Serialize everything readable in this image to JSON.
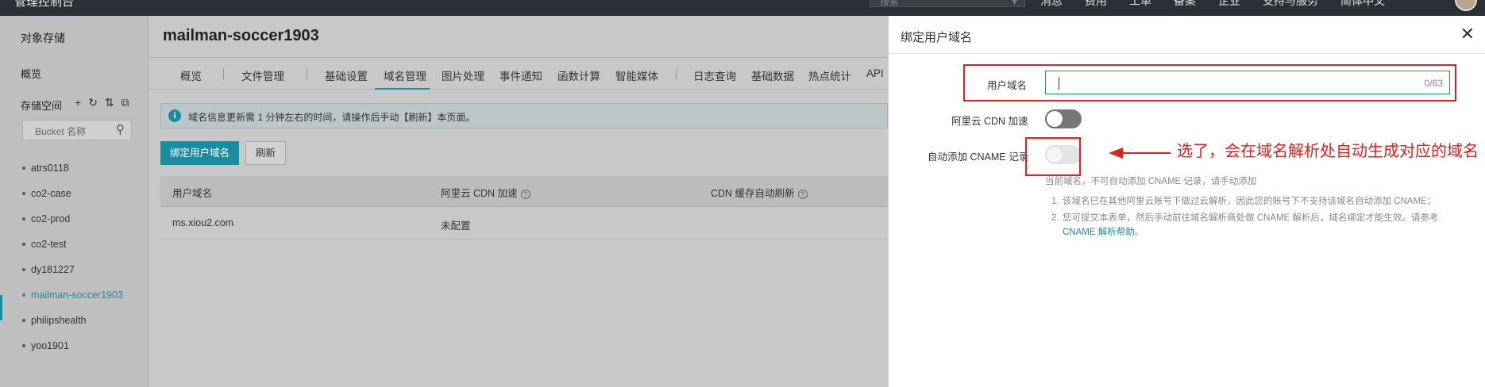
{
  "topbar": {
    "brand": "管理控制台",
    "search_placeholder": "搜索",
    "nav": [
      "消息",
      "费用",
      "工单",
      "备案",
      "企业",
      "支持与服务",
      "简体中文"
    ]
  },
  "sidebar": {
    "title": "对象存储",
    "overview": "概览",
    "storage_space": "存储空间",
    "tool_icons": [
      "+",
      "↻",
      "⇅",
      "⧉"
    ],
    "search_placeholder": "Bucket 名称",
    "buckets": [
      "atrs0118",
      "co2-case",
      "co2-prod",
      "co2-test",
      "dy181227",
      "mailman-soccer1903",
      "philipshealth",
      "yoo1901"
    ],
    "active_bucket": "mailman-soccer1903"
  },
  "main": {
    "bucket_title": "mailman-soccer1903",
    "tabs": [
      "概览",
      "文件管理",
      "基础设置",
      "域名管理",
      "图片处理",
      "事件通知",
      "函数计算",
      "智能媒体",
      "日志查询",
      "基础数据",
      "热点统计",
      "API"
    ],
    "active_tab": "域名管理",
    "notice": "域名信息更新需 1 分钟左右的时间，请操作后手动【刷新】本页面。",
    "bind_button": "绑定用户域名",
    "refresh_button": "刷新",
    "table": {
      "headers": [
        "用户域名",
        "阿里云 CDN 加速",
        "CDN 缓存自动刷新"
      ],
      "rows": [
        [
          "ms.xiou2.com",
          "未配置"
        ]
      ]
    }
  },
  "panel": {
    "title": "绑定用户域名",
    "domain_label": "用户域名",
    "domain_value": "",
    "domain_counter": "0/63",
    "cdn_label": "阿里云 CDN 加速",
    "cdn_toggle": "off",
    "cname_label": "自动添加 CNAME 记录",
    "cname_toggle": "disabled",
    "help_title": "当前域名，不可自动添加 CNAME 记录，请手动添加",
    "help_items": [
      {
        "num": "1.",
        "text": "该域名已在其他阿里云账号下做过云解析，因此您的账号下不支持该域名自动添加 CNAME；"
      },
      {
        "num": "2.",
        "text": "您可提交本表单，然后手动前往域名解析商处做 CNAME 解析后，域名绑定才能生效。请参考 ",
        "link": "CNAME 解析帮助",
        "tail": "。"
      }
    ]
  },
  "annotation": {
    "text": "选了，会在域名解析处自动生成对应的域名",
    "color": "#ea1c1c"
  },
  "colors": {
    "accent": "#1a8ea0",
    "annotation_red": "#ea1c1c"
  }
}
